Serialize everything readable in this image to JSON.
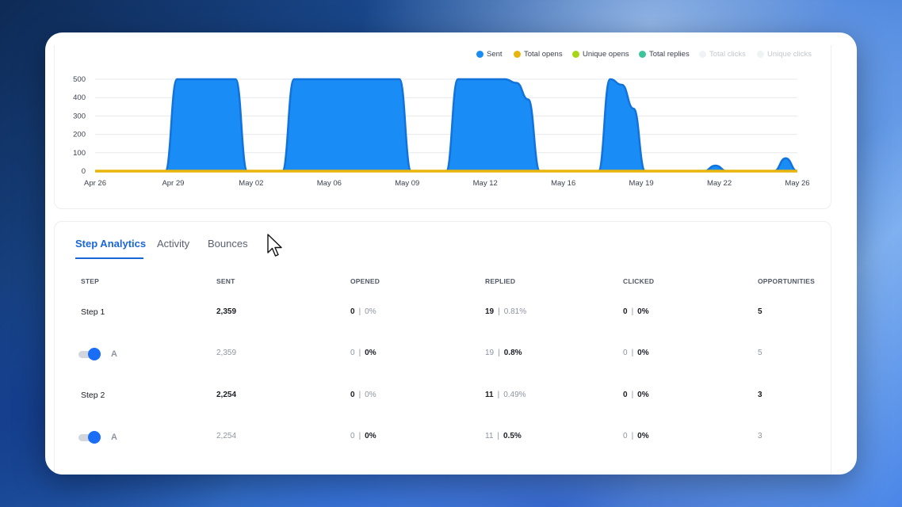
{
  "legend": [
    {
      "label": "Sent",
      "color": "#1a8cf5",
      "muted": false
    },
    {
      "label": "Total opens",
      "color": "#e8b50f",
      "muted": false
    },
    {
      "label": "Unique opens",
      "color": "#a8d41a",
      "muted": false
    },
    {
      "label": "Total replies",
      "color": "#3cc59a",
      "muted": false
    },
    {
      "label": "Total clicks",
      "color": "#f0f2f5",
      "muted": true
    },
    {
      "label": "Unique clicks",
      "color": "#eef4f4",
      "muted": true
    }
  ],
  "chart_data": {
    "type": "area",
    "y_ticks": [
      "500",
      "400",
      "300",
      "200",
      "100",
      "0"
    ],
    "ylim": [
      0,
      500
    ],
    "x_ticks": [
      "Apr 26",
      "Apr 29",
      "May 02",
      "May 06",
      "May 09",
      "May 12",
      "May 16",
      "May 19",
      "May 22",
      "May 26"
    ],
    "grid": true,
    "legend_position": "top-right",
    "series": [
      {
        "name": "Sent",
        "color": "#1a8cf5",
        "x": [
          0,
          1,
          1.5,
          2,
          2.5,
          3,
          3.5,
          4,
          4.5,
          5,
          5.5,
          6,
          6.5,
          7,
          7.5,
          8,
          8.5,
          9,
          9.5,
          10,
          10.5,
          11,
          11.5,
          12,
          12.5,
          13,
          13.5,
          14,
          14.5,
          15,
          15.5,
          16,
          16.5,
          17,
          17.5,
          18,
          18.5,
          19,
          19.5,
          20,
          20.5,
          21,
          21.5,
          22,
          22.5,
          23,
          23.5,
          24,
          24.5,
          25,
          25.5,
          26,
          26.5,
          27,
          27.5,
          28,
          28.5,
          29,
          29.5,
          30
        ],
        "values": [
          0,
          0,
          0,
          0,
          0,
          0,
          500,
          500,
          500,
          500,
          500,
          500,
          0,
          0,
          0,
          0,
          500,
          500,
          500,
          500,
          500,
          500,
          500,
          500,
          500,
          500,
          0,
          0,
          0,
          0,
          500,
          500,
          500,
          500,
          500,
          480,
          390,
          0,
          0,
          0,
          0,
          0,
          0,
          500,
          470,
          340,
          0,
          0,
          0,
          0,
          0,
          0,
          30,
          0,
          0,
          0,
          0,
          0,
          70,
          0
        ]
      },
      {
        "name": "Total opens",
        "color": "#e8b50f",
        "x": [
          0,
          30
        ],
        "values": [
          0,
          0
        ]
      }
    ]
  },
  "tabs": [
    {
      "label": "Step Analytics",
      "active": true
    },
    {
      "label": "Activity",
      "active": false
    },
    {
      "label": "Bounces",
      "active": false
    }
  ],
  "columns": [
    "STEP",
    "SENT",
    "OPENED",
    "REPLIED",
    "CLICKED",
    "OPPORTUNITIES"
  ],
  "rows": [
    {
      "kind": "step",
      "label": "Step 1",
      "sent": "2,359",
      "opened": "0",
      "opened_pct": "0%",
      "replied": "19",
      "replied_pct": "0.81%",
      "clicked": "0",
      "clicked_pct": "0%",
      "opps": "5"
    },
    {
      "kind": "variant",
      "label": "A",
      "enabled": true,
      "sent": "2,359",
      "opened": "0",
      "opened_pct": "0%",
      "replied": "19",
      "replied_pct": "0.8%",
      "clicked": "0",
      "clicked_pct": "0%",
      "opps": "5"
    },
    {
      "kind": "step",
      "label": "Step 2",
      "sent": "2,254",
      "opened": "0",
      "opened_pct": "0%",
      "replied": "11",
      "replied_pct": "0.49%",
      "clicked": "0",
      "clicked_pct": "0%",
      "opps": "3"
    },
    {
      "kind": "variant",
      "label": "A",
      "enabled": true,
      "sent": "2,254",
      "opened": "0",
      "opened_pct": "0%",
      "replied": "11",
      "replied_pct": "0.5%",
      "clicked": "0",
      "clicked_pct": "0%",
      "opps": "3"
    }
  ],
  "separator": "|",
  "icons": {
    "cursor": "mouse-pointer-icon",
    "toggle": "toggle-switch-icon"
  }
}
